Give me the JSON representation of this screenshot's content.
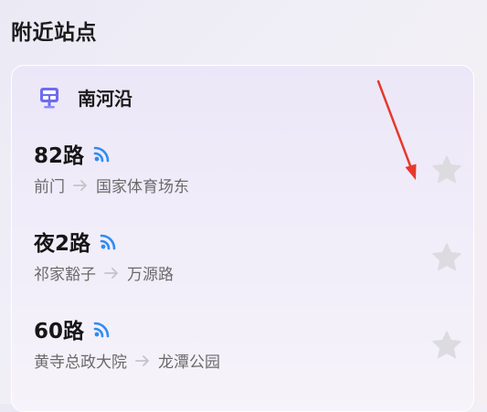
{
  "section": {
    "title": "附近站点"
  },
  "station": {
    "name": "南河沿",
    "icon": "bus-stop-sign-icon",
    "routes": [
      {
        "name": "82路",
        "from": "前门",
        "to": "国家体育场东",
        "signal_icon": "realtime-signal-icon",
        "favorite_icon": "star-icon"
      },
      {
        "name": "夜2路",
        "from": "祁家豁子",
        "to": "万源路",
        "signal_icon": "realtime-signal-icon",
        "favorite_icon": "star-icon"
      },
      {
        "name": "60路",
        "from": "黄寺总政大院",
        "to": "龙潭公园",
        "signal_icon": "realtime-signal-icon",
        "favorite_icon": "star-icon"
      }
    ]
  },
  "colors": {
    "signal_blue": "#2f8cf0",
    "station_icon_purple": "#6d6cf0",
    "star_gray": "#dcdce0",
    "annotation_red": "#e6392c"
  }
}
